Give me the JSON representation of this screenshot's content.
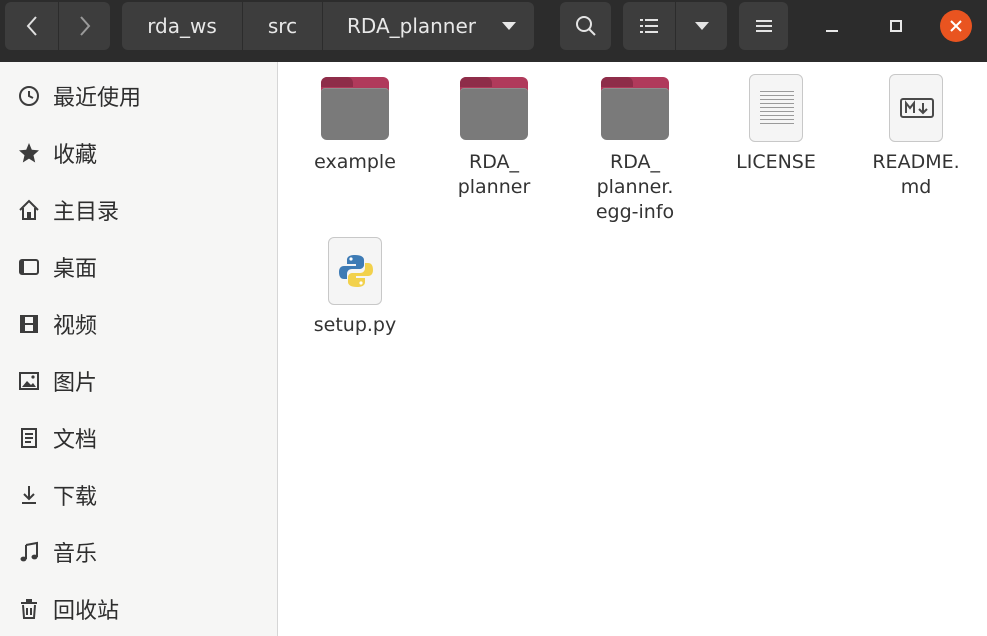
{
  "header": {
    "breadcrumbs": [
      "rda_ws",
      "src",
      "RDA_planner"
    ]
  },
  "sidebar": {
    "items": [
      {
        "label": "最近使用",
        "icon": "clock-icon"
      },
      {
        "label": "收藏",
        "icon": "star-icon"
      },
      {
        "label": "主目录",
        "icon": "home-icon"
      },
      {
        "label": "桌面",
        "icon": "desktop-icon"
      },
      {
        "label": "视频",
        "icon": "video-icon"
      },
      {
        "label": "图片",
        "icon": "picture-icon"
      },
      {
        "label": "文档",
        "icon": "document-icon"
      },
      {
        "label": "下载",
        "icon": "download-icon"
      },
      {
        "label": "音乐",
        "icon": "music-icon"
      },
      {
        "label": "回收站",
        "icon": "trash-icon"
      }
    ]
  },
  "files": [
    {
      "name": "example",
      "type": "folder"
    },
    {
      "name": "RDA_\nplanner",
      "type": "folder"
    },
    {
      "name": "RDA_\nplanner.\negg-info",
      "type": "folder"
    },
    {
      "name": "LICENSE",
      "type": "text"
    },
    {
      "name": "README.\nmd",
      "type": "markdown"
    },
    {
      "name": "setup.py",
      "type": "python"
    }
  ],
  "colors": {
    "accent": "#e95420",
    "folder_back": "#b03a5b",
    "folder_front": "#7a7a7a",
    "headerbar": "#2c2c2c"
  }
}
